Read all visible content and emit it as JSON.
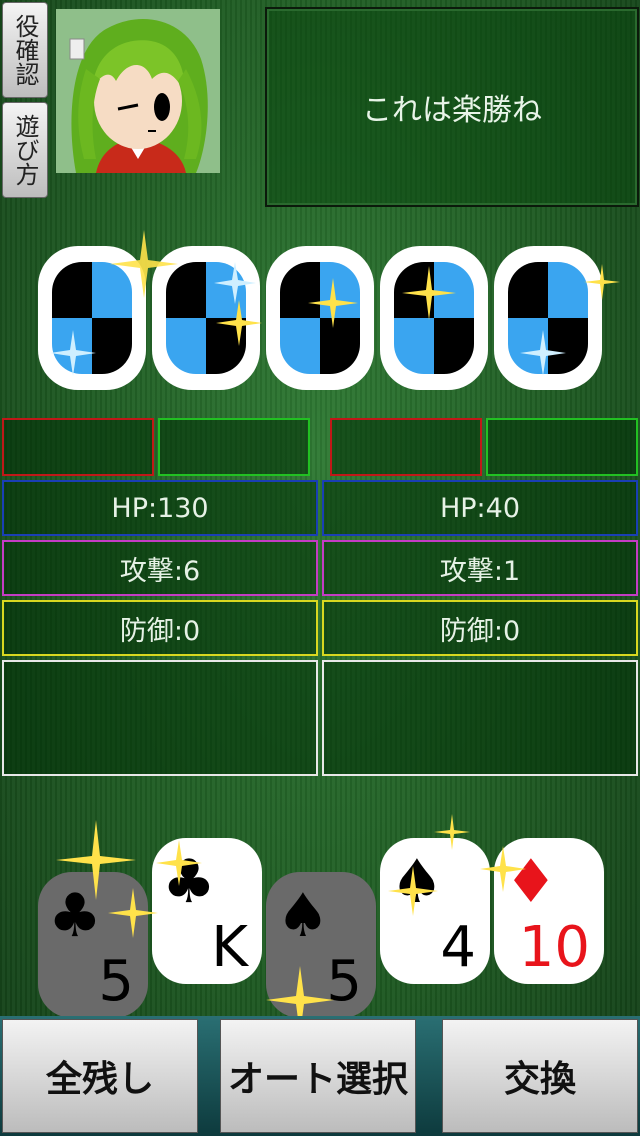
{
  "sidebar": {
    "hand_list_label": "役確認",
    "how_to_play_label": "遊び方"
  },
  "message": "これは楽勝ね",
  "enemy_cards": [
    {
      "state": "face-down"
    },
    {
      "state": "face-down"
    },
    {
      "state": "face-down"
    },
    {
      "state": "face-down"
    },
    {
      "state": "face-down"
    }
  ],
  "player": {
    "hp": "HP:130",
    "attack": "攻撃:6",
    "defense": "防御:0"
  },
  "opponent": {
    "hp": "HP:40",
    "attack": "攻撃:1",
    "defense": "防御:0"
  },
  "hand": [
    {
      "suit": "♣",
      "rank": "5",
      "held": false,
      "color": "#000000"
    },
    {
      "suit": "♣",
      "rank": "K",
      "held": true,
      "color": "#000000"
    },
    {
      "suit": "♠",
      "rank": "5",
      "held": false,
      "color": "#000000"
    },
    {
      "suit": "♠",
      "rank": "4",
      "held": true,
      "color": "#000000"
    },
    {
      "suit": "♦",
      "rank": "10",
      "held": true,
      "color": "#e8141b"
    }
  ],
  "actions": {
    "keep_all": "全残し",
    "auto_select": "オート選択",
    "exchange": "交換"
  },
  "colors": {
    "felt": "#1e5a22",
    "card_back_blue": "#3aa5f0",
    "hp_border": "#1a3fb5",
    "attack_border": "#c43cc4",
    "defense_border": "#d8d820",
    "slot_red": "#c01818",
    "slot_green": "#22c022"
  }
}
